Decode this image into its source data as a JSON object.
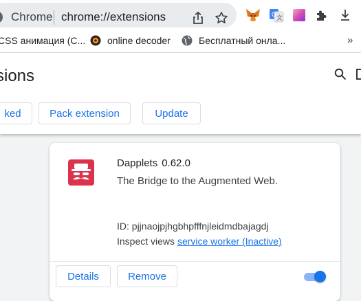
{
  "browser": {
    "site_name": "Chrome",
    "url": "chrome://extensions",
    "icons": {
      "share": "share-icon",
      "bookmark": "star-icon",
      "extensions": [
        "metamask-fox-icon",
        "google-translate-icon",
        "gradient-extension-icon",
        "puzzle-icon",
        "download-icon"
      ]
    }
  },
  "bookmarks": {
    "items": [
      {
        "label": "CSS анимация (С...",
        "icon": "globe-icon"
      },
      {
        "label": "online decoder",
        "icon": "decoder-favicon"
      },
      {
        "label": "Бесплатный онла...",
        "icon": "globe-icon"
      }
    ],
    "more": "»"
  },
  "header": {
    "title": "sions",
    "buttons": {
      "load_unpacked": "ked",
      "pack_extension": "Pack extension",
      "update": "Update"
    }
  },
  "extension": {
    "name": "Dapplets",
    "version": "0.62.0",
    "description": "The Bridge to the Augmented Web.",
    "id_label": "ID: pjjnaojpjhgbhpfffnjleidmdbajagdj",
    "inspect_prefix": "Inspect views",
    "inspect_link": "service worker (Inactive)",
    "details_button": "Details",
    "remove_button": "Remove",
    "enabled": true
  },
  "colors": {
    "accent": "#1a73e8",
    "logo_red": "#d9344b",
    "toggle_track": "#8ab4f8"
  }
}
